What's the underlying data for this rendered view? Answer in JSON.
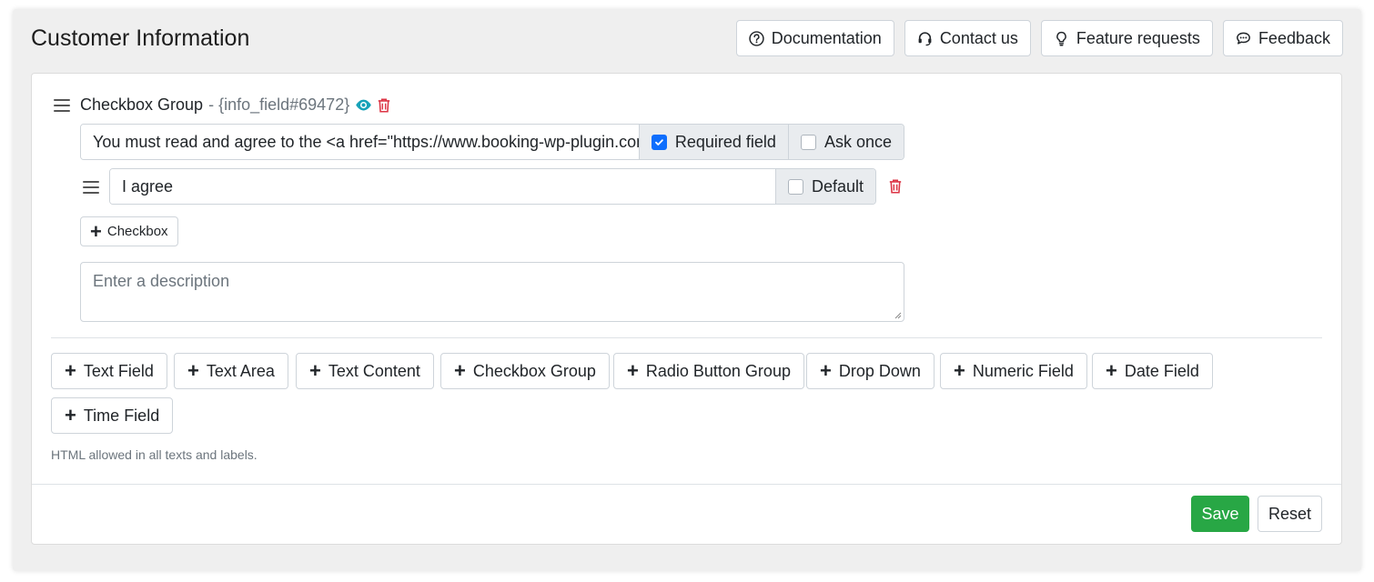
{
  "page": {
    "title": "Customer Information"
  },
  "top_actions": [
    {
      "label": "Documentation",
      "icon": "question-circle-icon"
    },
    {
      "label": "Contact us",
      "icon": "headset-icon"
    },
    {
      "label": "Feature requests",
      "icon": "lightbulb-icon"
    },
    {
      "label": "Feedback",
      "icon": "chat-icon"
    }
  ],
  "field": {
    "title": "Checkbox Group",
    "sub": "- {info_field#69472}",
    "label_value": "You must read and agree to the <a href=\"https://www.booking-wp-plugin.com/",
    "required_label": "Required field",
    "required_checked": true,
    "ask_once_label": "Ask once",
    "ask_once_checked": false,
    "options": [
      {
        "value": "I agree",
        "default_label": "Default",
        "default_checked": false
      }
    ],
    "add_checkbox_label": "Checkbox",
    "description_placeholder": "Enter a description"
  },
  "add_buttons": [
    "Text Field",
    "Text Area",
    "Text Content",
    "Checkbox Group",
    "Radio Button Group",
    "Drop Down",
    "Numeric Field",
    "Date Field",
    "Time Field"
  ],
  "note": "HTML allowed in all texts and labels.",
  "footer": {
    "save_label": "Save",
    "reset_label": "Reset"
  },
  "colors": {
    "accent": "#0d6efd",
    "danger": "#dc3545",
    "success": "#28a745",
    "eye": "#17a2b8"
  }
}
